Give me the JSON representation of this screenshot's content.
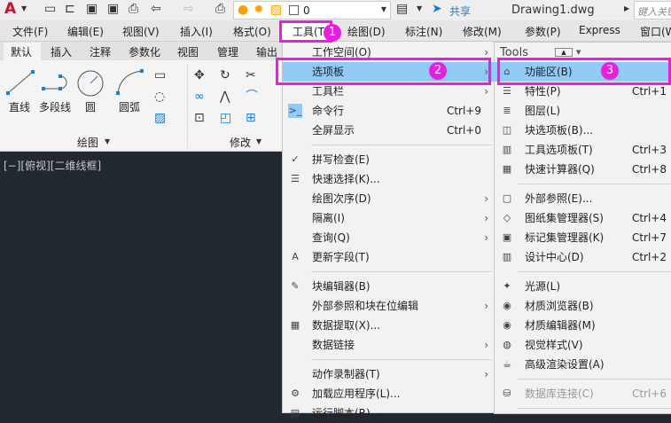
{
  "qat": {
    "layer_value": "0",
    "share": "共享",
    "doc_title": "Drawing1.dwg",
    "search_placeholder": "键入关键字"
  },
  "menubar": [
    {
      "label": "文件(F)"
    },
    {
      "label": "编辑(E)"
    },
    {
      "label": "视图(V)"
    },
    {
      "label": "插入(I)"
    },
    {
      "label": "格式(O)"
    },
    {
      "label": "工具(T)"
    },
    {
      "label": "绘图(D)"
    },
    {
      "label": "标注(N)"
    },
    {
      "label": "修改(M)"
    },
    {
      "label": "参数(P)"
    },
    {
      "label": "Express"
    },
    {
      "label": "窗口(W)"
    }
  ],
  "ribbon_tabs": [
    {
      "label": "默认"
    },
    {
      "label": "插入"
    },
    {
      "label": "注释"
    },
    {
      "label": "参数化"
    },
    {
      "label": "视图"
    },
    {
      "label": "管理"
    },
    {
      "label": "输出"
    }
  ],
  "ribbon": {
    "line": "直线",
    "polyline": "多段线",
    "circle": "圆",
    "arc": "圆弧",
    "draw_panel": "绘图",
    "modify_panel": "修改"
  },
  "canvas_label": "[−][俯视][二维线框]",
  "badges": [
    "1",
    "2",
    "3"
  ],
  "tools_menu": [
    {
      "label": "工作空间(O)",
      "sub": true
    },
    {
      "label": "选项板",
      "sub": true,
      "hl": true
    },
    {
      "label": "工具栏",
      "sub": true
    },
    {
      "label": "命令行",
      "key": "Ctrl+9",
      "icon": "command-line"
    },
    {
      "label": "全屏显示",
      "key": "Ctrl+0"
    },
    {
      "sep": true
    },
    {
      "label": "拼写检查(E)",
      "icon": "spell-check"
    },
    {
      "label": "快速选择(K)...",
      "icon": "quick-select"
    },
    {
      "label": "绘图次序(D)",
      "sub": true
    },
    {
      "label": "隔离(I)",
      "sub": true
    },
    {
      "label": "查询(Q)",
      "sub": true
    },
    {
      "label": "更新字段(T)",
      "icon": "update-field"
    },
    {
      "sep": true
    },
    {
      "label": "块编辑器(B)",
      "icon": "block-editor"
    },
    {
      "label": "外部参照和块在位编辑",
      "sub": true
    },
    {
      "label": "数据提取(X)...",
      "icon": "data-extract"
    },
    {
      "label": "数据链接",
      "sub": true
    },
    {
      "sep": true
    },
    {
      "label": "动作录制器(T)",
      "sub": true
    },
    {
      "label": "加载应用程序(L)...",
      "icon": "load-app"
    },
    {
      "label": "运行脚本(R)...",
      "icon": "run-script"
    }
  ],
  "palettes_header": "Tools",
  "palettes_menu": [
    {
      "label": "功能区(B)",
      "hl": true,
      "icon": "ribbon"
    },
    {
      "label": "特性(P)",
      "key": "Ctrl+1",
      "icon": "properties"
    },
    {
      "label": "图层(L)",
      "icon": "layers"
    },
    {
      "label": "块选项板(B)...",
      "icon": "block-palette"
    },
    {
      "label": "工具选项板(T)",
      "key": "Ctrl+3",
      "icon": "tool-palette"
    },
    {
      "label": "快速计算器(Q)",
      "key": "Ctrl+8",
      "icon": "calculator"
    },
    {
      "sep": true
    },
    {
      "label": "外部参照(E)...",
      "icon": "xref"
    },
    {
      "label": "图纸集管理器(S)",
      "key": "Ctrl+4",
      "icon": "sheet-set"
    },
    {
      "label": "标记集管理器(K)",
      "key": "Ctrl+7",
      "icon": "markup-set"
    },
    {
      "label": "设计中心(D)",
      "key": "Ctrl+2",
      "icon": "design-center"
    },
    {
      "sep": true
    },
    {
      "label": "光源(L)",
      "icon": "lights"
    },
    {
      "label": "材质浏览器(B)",
      "icon": "material-browser"
    },
    {
      "label": "材质编辑器(M)",
      "icon": "material-editor"
    },
    {
      "label": "视觉样式(V)",
      "icon": "visual-styles"
    },
    {
      "label": "高级渲染设置(A)",
      "icon": "render-settings"
    },
    {
      "sep": true
    },
    {
      "label": "数据库连接(C)",
      "key": "Ctrl+6",
      "icon": "db-connect",
      "disabled": true
    },
    {
      "sep": true
    }
  ]
}
